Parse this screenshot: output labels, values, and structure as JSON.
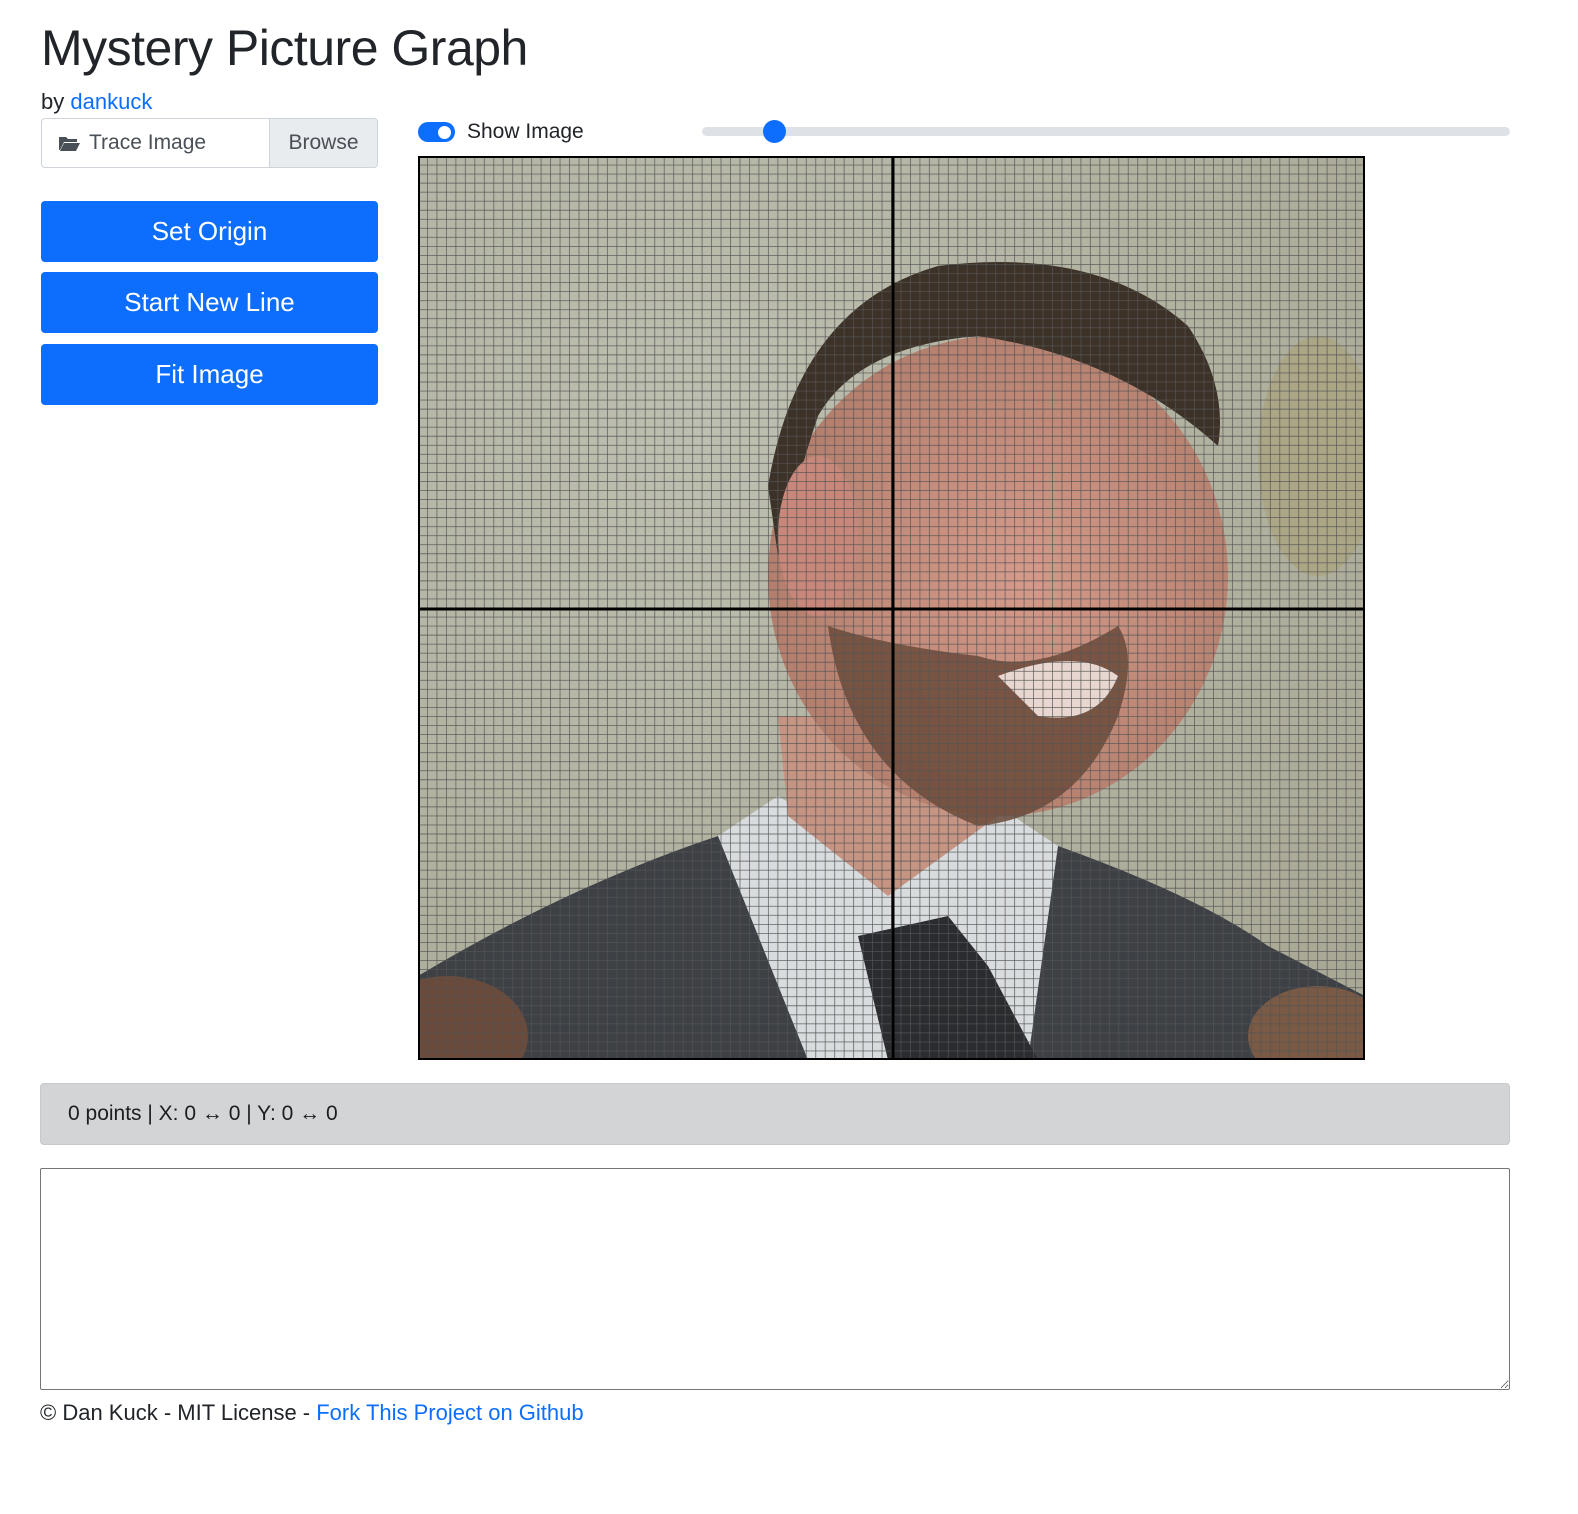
{
  "header": {
    "title": "Mystery Picture Graph",
    "by_prefix": "by",
    "author_link": "dankuck"
  },
  "controls": {
    "file_label": "Trace Image",
    "file_icon": "folder-open-icon",
    "browse_label": "Browse",
    "buttons": {
      "set_origin": "Set Origin",
      "start_new_line": "Start New Line",
      "fit_image": "Fit Image"
    },
    "show_image": {
      "label": "Show Image",
      "checked": true
    },
    "opacity_slider": {
      "value_percent": 9
    }
  },
  "graph": {
    "image_description_hint": "traced photo",
    "grid_color": "#555555",
    "axis_color": "#000000"
  },
  "status": {
    "text": "0 points | X: 0 ↔ 0 | Y: 0 ↔ 0"
  },
  "output": {
    "value": "",
    "placeholder": ""
  },
  "footer": {
    "copyright": "© Dan Kuck - MIT License - ",
    "link": "Fork This Project on Github"
  },
  "colors": {
    "primary": "#0d6efd",
    "status_bg": "#d3d4d6"
  }
}
